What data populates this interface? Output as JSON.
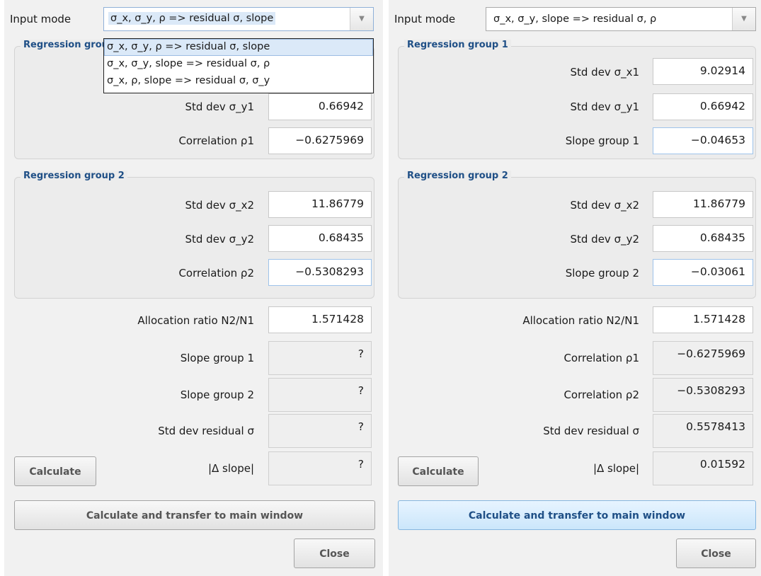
{
  "left": {
    "input_mode_label": "Input mode",
    "input_mode_value": "σ_x, σ_y, ρ => residual σ, slope",
    "dropdown_options": [
      "σ_x, σ_y, ρ => residual σ, slope",
      "σ_x, σ_y, slope => residual σ, ρ",
      "σ_x, ρ, slope => residual σ, σ_y"
    ],
    "group1": {
      "title": "Regression group 1",
      "rows": [
        {
          "label": "Std dev σ_y1",
          "value": "0.66942"
        },
        {
          "label": "Correlation ρ1",
          "value": "−0.6275969"
        }
      ]
    },
    "group2": {
      "title": "Regression group 2",
      "rows": [
        {
          "label": "Std dev σ_x2",
          "value": "11.86779"
        },
        {
          "label": "Std dev σ_y2",
          "value": "0.68435"
        },
        {
          "label": "Correlation ρ2",
          "value": "−0.5308293"
        }
      ]
    },
    "allocation": {
      "label": "Allocation ratio N2/N1",
      "value": "1.571428"
    },
    "outputs": [
      {
        "label": "Slope group 1",
        "value": "?"
      },
      {
        "label": "Slope group 2",
        "value": "?"
      },
      {
        "label": "Std dev residual σ",
        "value": "?"
      },
      {
        "label": "|Δ slope|",
        "value": "?"
      }
    ],
    "calculate_label": "Calculate",
    "transfer_label": "Calculate and transfer to main window",
    "close_label": "Close"
  },
  "right": {
    "input_mode_label": "Input mode",
    "input_mode_value": "σ_x, σ_y, slope => residual σ, ρ",
    "group1": {
      "title": "Regression group 1",
      "rows": [
        {
          "label": "Std dev σ_x1",
          "value": "9.02914"
        },
        {
          "label": "Std dev σ_y1",
          "value": "0.66942"
        },
        {
          "label": "Slope group 1",
          "value": "−0.04653"
        }
      ]
    },
    "group2": {
      "title": "Regression group 2",
      "rows": [
        {
          "label": "Std dev σ_x2",
          "value": "11.86779"
        },
        {
          "label": "Std dev σ_y2",
          "value": "0.68435"
        },
        {
          "label": "Slope group 2",
          "value": "−0.03061"
        }
      ]
    },
    "allocation": {
      "label": "Allocation ratio N2/N1",
      "value": "1.571428"
    },
    "outputs": [
      {
        "label": "Correlation ρ1",
        "value": "−0.6275969"
      },
      {
        "label": "Correlation ρ2",
        "value": "−0.5308293"
      },
      {
        "label": "Std dev residual σ",
        "value": "0.5578413"
      },
      {
        "label": "|Δ slope|",
        "value": "0.01592"
      }
    ],
    "calculate_label": "Calculate",
    "transfer_label": "Calculate and transfer to main window",
    "close_label": "Close"
  },
  "icons": {
    "dropdown_arrow": "chevron-down-icon"
  }
}
